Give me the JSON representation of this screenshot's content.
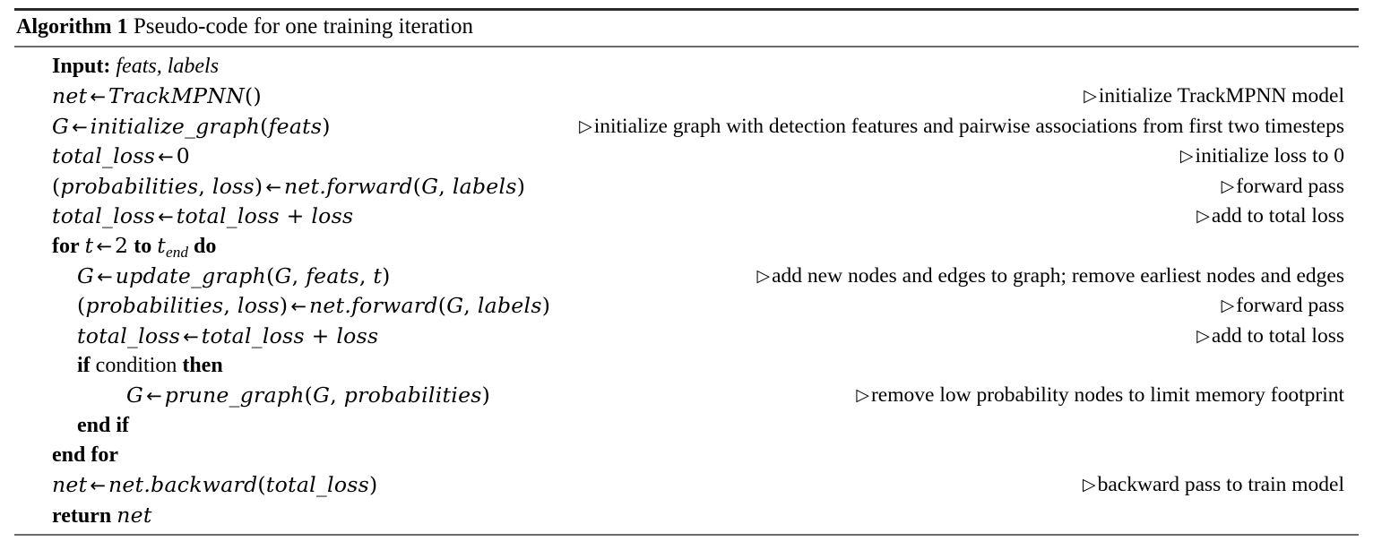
{
  "algorithm": {
    "label": "Algorithm 1",
    "title": "Pseudo-code for one training iteration",
    "lines": [
      {
        "id": "input",
        "indent": 0,
        "keyword": "Input:",
        "text_italic": " feats, labels",
        "comment": ""
      },
      {
        "id": "net-init",
        "indent": 0,
        "math": "net ← TrackMPNN()",
        "comment": "initialize TrackMPNN model"
      },
      {
        "id": "graph-init",
        "indent": 0,
        "math": "G ← initialize_graph(feats)",
        "comment": "initialize graph with detection features and pairwise associations from first two timesteps"
      },
      {
        "id": "total-loss-zero",
        "indent": 0,
        "math": "total_loss ← 0",
        "comment": "initialize loss to 0"
      },
      {
        "id": "forward-first",
        "indent": 0,
        "math": "(probabilities, loss) ← net.forward(G, labels)",
        "comment": "forward pass"
      },
      {
        "id": "accumulate-first",
        "indent": 0,
        "math": "total_loss ← total_loss + loss",
        "comment": "add to total loss"
      },
      {
        "id": "for-loop",
        "indent": 0,
        "keyword": "for",
        "loop_var": "t",
        "loop_from": "2",
        "keyword_to": "to",
        "loop_to": "t",
        "loop_to_sub": "end",
        "keyword_do": "do",
        "comment": ""
      },
      {
        "id": "graph-update",
        "indent": 1,
        "math": "G ← update_graph(G, feats, t)",
        "comment": "add new nodes and edges to graph; remove earliest nodes and edges"
      },
      {
        "id": "forward-loop",
        "indent": 1,
        "math": "(probabilities, loss) ← net.forward(G, labels)",
        "comment": "forward pass"
      },
      {
        "id": "accumulate-loop",
        "indent": 1,
        "math": "total_loss ← total_loss + loss",
        "comment": "add to total loss"
      },
      {
        "id": "if-condition",
        "indent": 1,
        "keyword": "if",
        "condition": "condition",
        "keyword_then": "then",
        "comment": ""
      },
      {
        "id": "graph-prune",
        "indent": 2,
        "math": "G ← prune_graph(G, probabilities)",
        "comment": "remove low probability nodes to limit memory footprint"
      },
      {
        "id": "end-if",
        "indent": 1,
        "keyword": "end if",
        "comment": ""
      },
      {
        "id": "end-for",
        "indent": 0,
        "keyword": "end for",
        "comment": ""
      },
      {
        "id": "backward",
        "indent": 0,
        "math": "net ← net.backward(total_loss)",
        "comment": "backward pass to train model"
      },
      {
        "id": "return",
        "indent": 0,
        "keyword": "return",
        "math_tail": "net",
        "comment": ""
      }
    ],
    "comment_marker": "▹"
  }
}
